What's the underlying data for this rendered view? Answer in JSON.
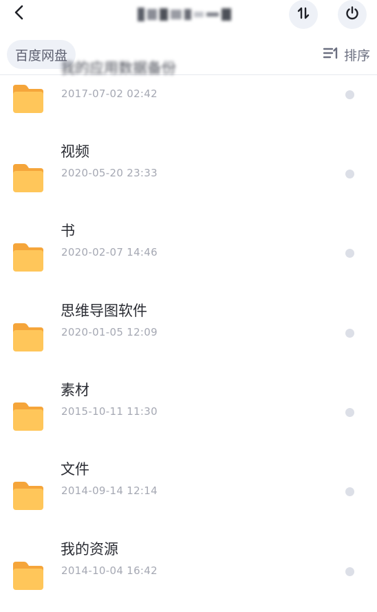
{
  "header": {
    "back_icon": "chevron-left-icon",
    "title": "百度网盘下载目录",
    "swap_icon": "swap-vertical-icon",
    "power_icon": "power-icon"
  },
  "subheader": {
    "breadcrumb": "百度网盘",
    "sort_label": "排序",
    "sort_icon": "sort-lines-icon"
  },
  "colors": {
    "accent_bg": "#eef1f7",
    "folder": "#ffc65a",
    "text_primary": "#2a2c33",
    "text_secondary": "#a5a8b3"
  },
  "files": [
    {
      "name": "我的应用数据备份",
      "date": "2017-07-02 02:42",
      "icon": "folder-icon"
    },
    {
      "name": "视频",
      "date": "2020-05-20 23:33",
      "icon": "folder-icon"
    },
    {
      "name": "书",
      "date": "2020-02-07 14:46",
      "icon": "folder-icon"
    },
    {
      "name": "思维导图软件",
      "date": "2020-01-05 12:09",
      "icon": "folder-icon"
    },
    {
      "name": "素材",
      "date": "2015-10-11 11:30",
      "icon": "folder-icon"
    },
    {
      "name": "文件",
      "date": "2014-09-14 12:14",
      "icon": "folder-icon"
    },
    {
      "name": "我的资源",
      "date": "2014-10-04 16:42",
      "icon": "folder-icon"
    }
  ]
}
